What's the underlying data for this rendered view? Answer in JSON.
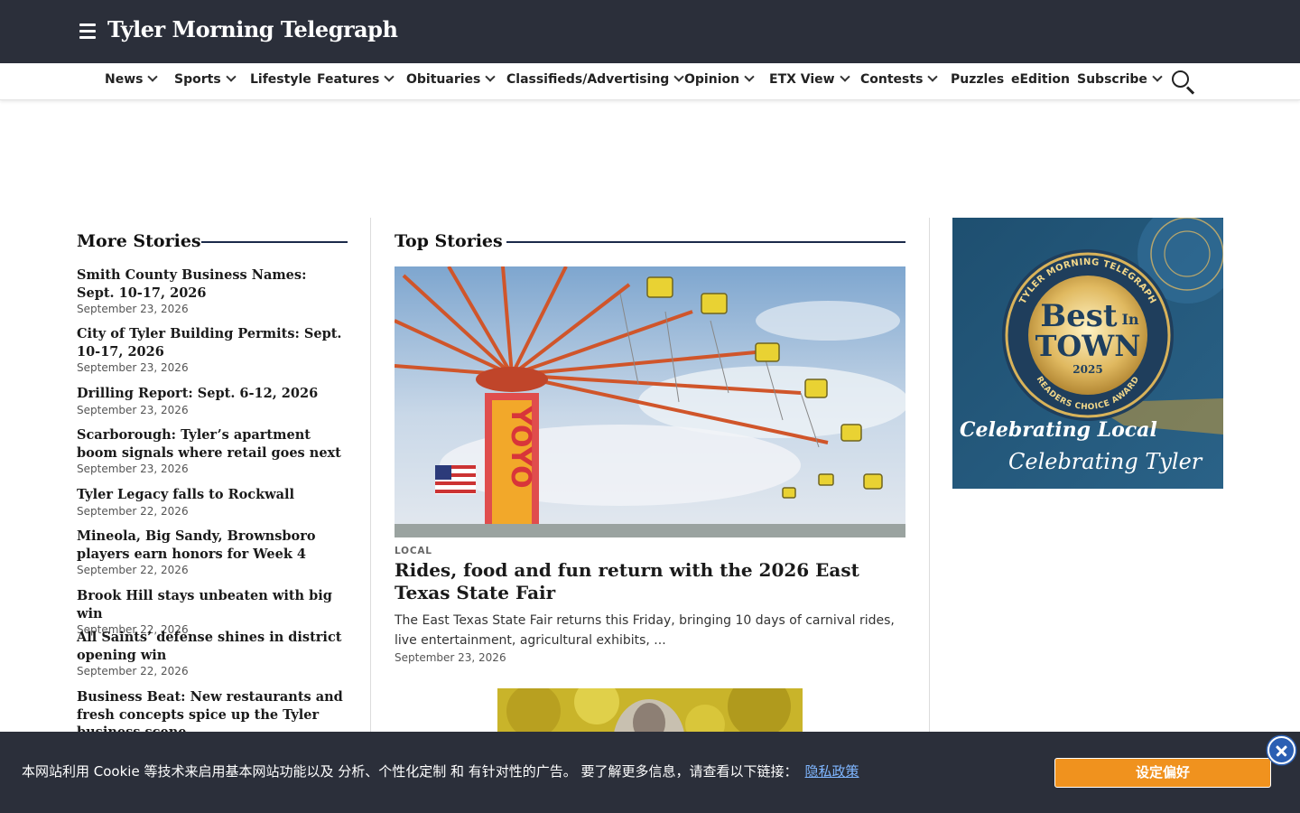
{
  "header": {
    "site_name": "Tyler Morning Telegraph",
    "menu_icon": "hamburger-menu-icon"
  },
  "nav": {
    "items": [
      {
        "label": "News",
        "has_dropdown": true
      },
      {
        "label": "Sports",
        "has_dropdown": true
      },
      {
        "label": "Lifestyle",
        "has_dropdown": false
      },
      {
        "label": "Features",
        "has_dropdown": true
      },
      {
        "label": "Obituaries",
        "has_dropdown": true
      },
      {
        "label": "Classifieds/Advertising",
        "has_dropdown": true
      },
      {
        "label": "Opinion",
        "has_dropdown": true
      },
      {
        "label": "ETX View",
        "has_dropdown": true
      },
      {
        "label": "Contests",
        "has_dropdown": true
      },
      {
        "label": "Puzzles",
        "has_dropdown": false
      },
      {
        "label": "eEdition",
        "has_dropdown": false
      },
      {
        "label": "Subscribe",
        "has_dropdown": true
      }
    ],
    "search_icon": "search-icon"
  },
  "more_stories": {
    "heading": "More Stories",
    "items": [
      {
        "title": "Smith County Business Names: Sept. 10-17, 2026",
        "date": "September 23, 2026"
      },
      {
        "title": "City of Tyler Building Permits: Sept. 10-17, 2026",
        "date": "September 23, 2026"
      },
      {
        "title": "Drilling Report: Sept. 6-12, 2026",
        "date": "September 23, 2026"
      },
      {
        "title": "Scarborough: Tyler’s apartment boom signals where retail goes next",
        "date": "September 23, 2026"
      },
      {
        "title": "Tyler Legacy falls to Rockwall",
        "date": "September 22, 2026"
      },
      {
        "title": "Mineola, Big Sandy, Brownsboro players earn honors for Week 4",
        "date": "September 22, 2026"
      },
      {
        "title": "Brook Hill stays unbeaten with big win",
        "date": "September 22, 2026"
      },
      {
        "title": "All Saints’ defense shines in district opening win",
        "date": "September 22, 2026"
      },
      {
        "title": "Business Beat: New restaurants and fresh concepts spice up the Tyler business scene",
        "date": ""
      }
    ]
  },
  "top_stories": {
    "heading": "Top Stories",
    "feature": {
      "kicker": "LOCAL",
      "ride_sign": "YOYO",
      "title": "Rides, food and fun return with the 2026 East Texas State Fair",
      "summary": "The East Texas State Fair returns this Friday, bringing 10 days of carnival rides, live entertainment, agricultural exhibits, ...",
      "date": "September 23, 2026"
    }
  },
  "ad": {
    "ring_text": "TYLER MORNING TELEGRAPH",
    "line1": "Best",
    "line1b": "In",
    "line2": "TOWN",
    "year": "2025",
    "award": "READERS CHOICE AWARD",
    "script1": "Celebrating Local",
    "script2": "Celebrating Tyler"
  },
  "cookie_banner": {
    "text": "本网站利用 Cookie 等技术来启用基本网站功能以及 分析、个性化定制 和 有针对性的广告。 要了解更多信息，请查看以下链接：",
    "link": "隐私政策",
    "button": "设定偏好",
    "close_icon": "close-icon"
  },
  "colors": {
    "header_bg": "#2b2f3a",
    "accent_rule": "#1b2a4a",
    "cookie_button": "#f0921e",
    "link": "#7fb6ff"
  }
}
